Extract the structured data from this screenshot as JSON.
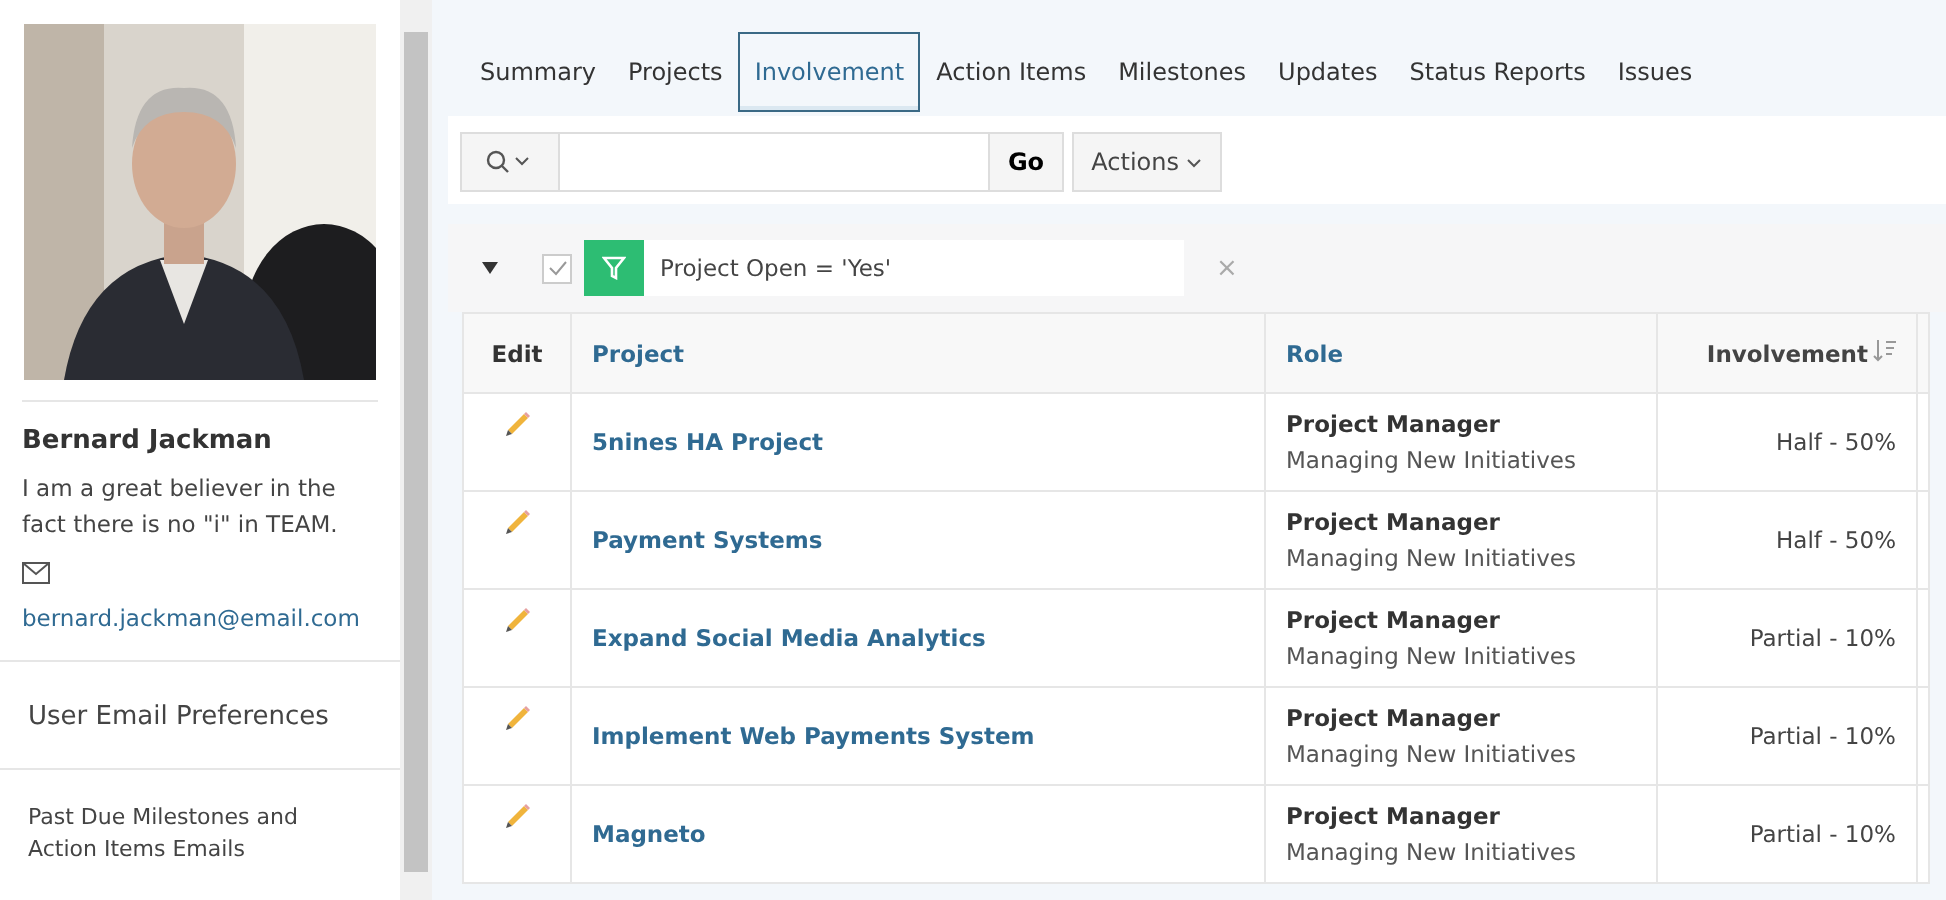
{
  "profile": {
    "name": "Bernard Jackman",
    "bio": "I am a great believer in the fact there is no \"i\" in TEAM.",
    "email": "bernard.jackman@email.com"
  },
  "preferences": [
    {
      "label": "User Email Preferences",
      "kind": "large"
    },
    {
      "label": "Past Due Milestones and Action Items Emails",
      "kind": "small"
    }
  ],
  "tabs": [
    {
      "label": "Summary",
      "selected": false
    },
    {
      "label": "Projects",
      "selected": false
    },
    {
      "label": "Involvement",
      "selected": true
    },
    {
      "label": "Action Items",
      "selected": false
    },
    {
      "label": "Milestones",
      "selected": false
    },
    {
      "label": "Updates",
      "selected": false
    },
    {
      "label": "Status Reports",
      "selected": false
    },
    {
      "label": "Issues",
      "selected": false
    }
  ],
  "toolbar": {
    "go": "Go",
    "actions": "Actions"
  },
  "filter": {
    "checked": true,
    "text": "Project Open = 'Yes'",
    "remove": "×"
  },
  "table": {
    "columns": [
      {
        "label": "Edit",
        "sorted": false
      },
      {
        "label": "Project",
        "sorted": false
      },
      {
        "label": "Role",
        "sorted": false
      },
      {
        "label": "Involvement",
        "sorted": true
      }
    ],
    "rows": [
      {
        "project": "5nines HA Project",
        "role": "Project Manager",
        "initiative": "Managing New Initiatives",
        "involvement": "Half - 50%"
      },
      {
        "project": "Payment Systems",
        "role": "Project Manager",
        "initiative": "Managing New Initiatives",
        "involvement": "Half - 50%"
      },
      {
        "project": "Expand Social Media Analytics",
        "role": "Project Manager",
        "initiative": "Managing New Initiatives",
        "involvement": "Partial - 10%"
      },
      {
        "project": "Implement Web Payments System",
        "role": "Project Manager",
        "initiative": "Managing New Initiatives",
        "involvement": "Partial - 10%"
      },
      {
        "project": "Magneto",
        "role": "Project Manager",
        "initiative": "Managing New Initiatives",
        "involvement": "Partial - 10%"
      }
    ]
  }
}
